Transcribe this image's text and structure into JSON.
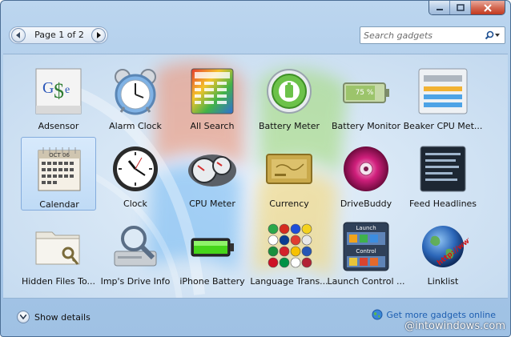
{
  "pager": {
    "label": "Page 1 of 2"
  },
  "search": {
    "placeholder": "Search gadgets"
  },
  "gadgets": [
    {
      "label": "Adsensor",
      "icon": "adsensor-icon"
    },
    {
      "label": "Alarm Clock",
      "icon": "alarm-clock-icon"
    },
    {
      "label": "All Search",
      "icon": "all-search-icon"
    },
    {
      "label": "Battery Meter",
      "icon": "battery-meter-icon"
    },
    {
      "label": "Battery Monitor",
      "icon": "battery-monitor-icon",
      "readout": "75 %"
    },
    {
      "label": "Beaker CPU Met...",
      "icon": "beaker-cpu-meter-icon"
    },
    {
      "label": "Calendar",
      "icon": "calendar-icon",
      "selected": true,
      "month": "OCT 06"
    },
    {
      "label": "Clock",
      "icon": "clock-icon"
    },
    {
      "label": "CPU Meter",
      "icon": "cpu-meter-icon"
    },
    {
      "label": "Currency",
      "icon": "currency-icon"
    },
    {
      "label": "DriveBuddy",
      "icon": "drivebuddy-icon"
    },
    {
      "label": "Feed Headlines",
      "icon": "feed-headlines-icon"
    },
    {
      "label": "Hidden Files To...",
      "icon": "hidden-files-icon"
    },
    {
      "label": "Imp's Drive Info",
      "icon": "drive-info-icon"
    },
    {
      "label": "iPhone Battery",
      "icon": "iphone-battery-icon"
    },
    {
      "label": "Language Trans...",
      "icon": "language-translator-icon"
    },
    {
      "label": "Launch Control ...",
      "icon": "launch-control-icon",
      "captions": [
        "Launch",
        "Control"
      ]
    },
    {
      "label": "Linklist",
      "icon": "linklist-icon",
      "stamp": "http://www"
    }
  ],
  "footer": {
    "details_label": "Show details",
    "more_label": "Get more gadgets online"
  },
  "watermark": "@intowindows.com",
  "colors": {
    "frame": "#a9c8e8",
    "selection": "#cfe3f8",
    "link": "#1e5fb1",
    "close": "#c2381e"
  }
}
